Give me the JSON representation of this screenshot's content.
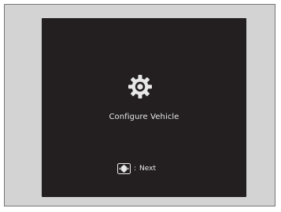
{
  "screen": {
    "title": "Configure Vehicle",
    "icon": "gear-icon",
    "hint": {
      "icon": "selector-dial-icon",
      "separator": ":",
      "label": "Next"
    }
  },
  "colors": {
    "screen_background": "#231f20",
    "frame_background": "#d3d3d3",
    "text": "#e8e8e8"
  }
}
